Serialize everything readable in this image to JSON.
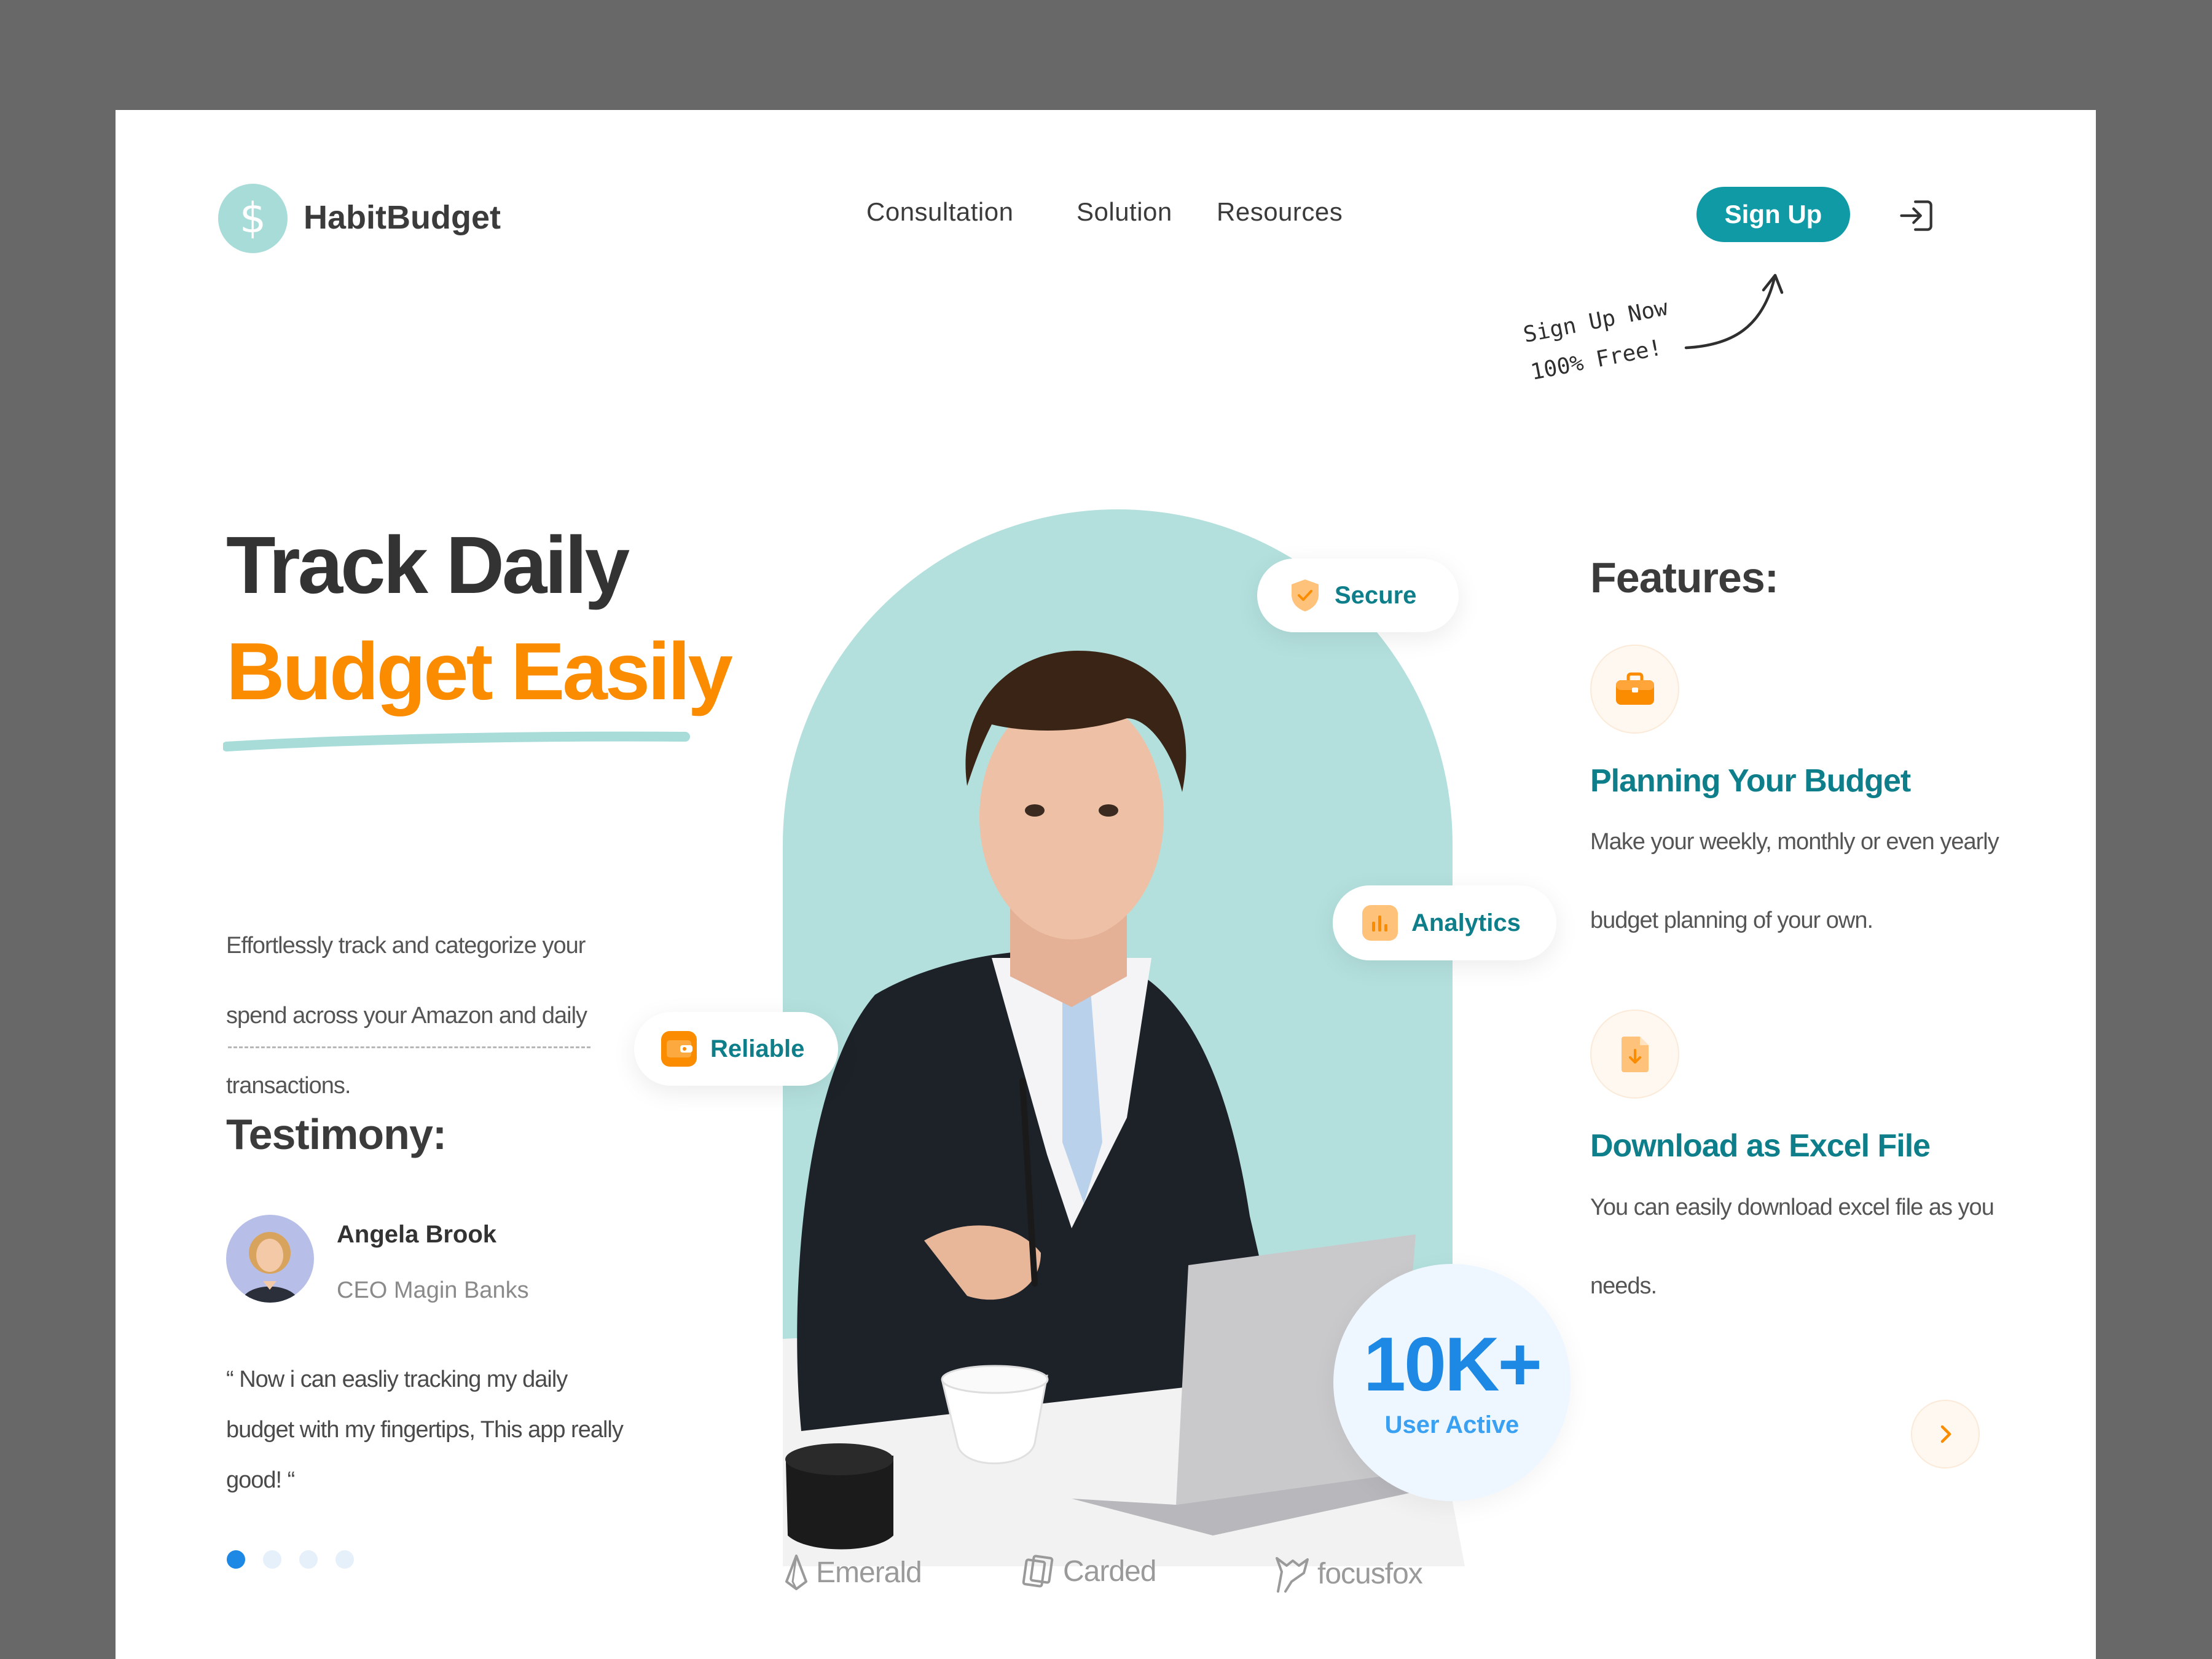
{
  "header": {
    "logo_symbol": "$",
    "logo_text": "HabitBudget",
    "nav": [
      "Consultation",
      "Solution",
      "Resources"
    ],
    "signup_label": "Sign Up",
    "login_icon": "login-icon",
    "promo_line1": "Sign Up Now",
    "promo_line2": "100% Free!"
  },
  "hero": {
    "title_line1": "Track Daily",
    "title_line2": "Budget Easily",
    "description_lines": [
      "Effortlessly track and categorize your",
      "spend across your Amazon and daily",
      "transactions."
    ]
  },
  "testimony": {
    "title": "Testimony:",
    "name": "Angela Brook",
    "role": "CEO Magin Banks",
    "quote_lines": [
      "“ Now i can easliy tracking my daily",
      "budget with my fingertips, This app really",
      "good! “"
    ],
    "carousel_pages": 4,
    "active_page": 1
  },
  "badges": {
    "secure": "Secure",
    "analytics": "Analytics",
    "reliable": "Reliable"
  },
  "stats": {
    "value": "10K+",
    "label": "User Active"
  },
  "features": {
    "title": "Features:",
    "items": [
      {
        "icon": "briefcase-icon",
        "title": "Planning Your Budget",
        "lines": [
          "Make your weekly, monthly or even yearly",
          "budget planning of your own."
        ]
      },
      {
        "icon": "download-file-icon",
        "title": "Download as Excel File",
        "lines": [
          "You can easily download excel file as you",
          "needs."
        ]
      }
    ],
    "next_icon": "chevron-right-icon"
  },
  "partners": [
    "Emerald",
    "Carded",
    "focusfox"
  ],
  "colors": {
    "teal": "#0f9aa6",
    "teal_text": "#0e7f8a",
    "mint": "#b3e0dd",
    "orange": "#fb8c00",
    "blue": "#1e88e5",
    "dark": "#333333"
  }
}
